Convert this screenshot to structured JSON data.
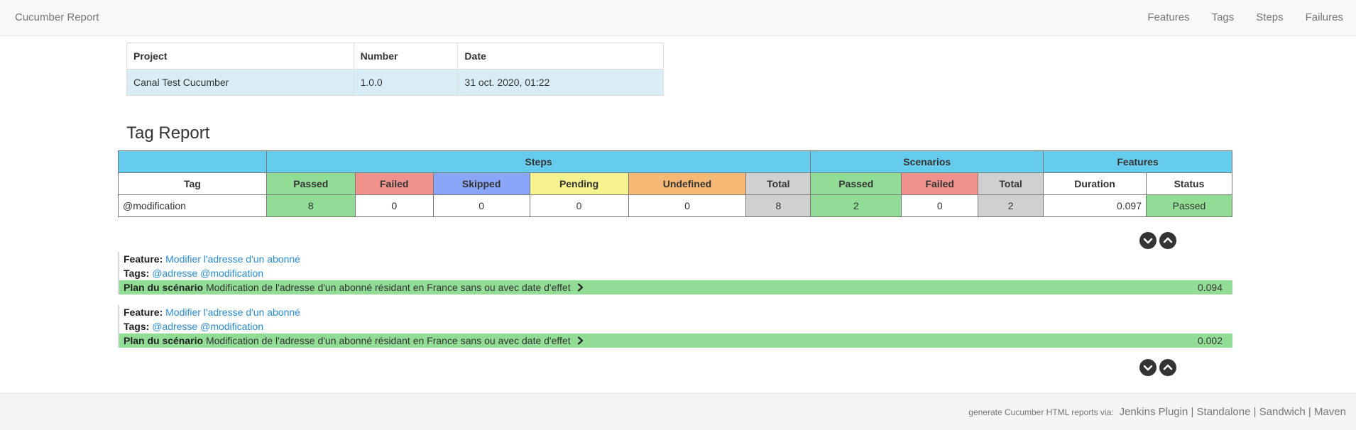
{
  "navbar": {
    "brand": "Cucumber Report",
    "links": [
      "Features",
      "Tags",
      "Steps",
      "Failures"
    ]
  },
  "project": {
    "headers": [
      "Project",
      "Number",
      "Date"
    ],
    "row": [
      "Canal Test Cucumber",
      "1.0.0",
      "31 oct. 2020, 01:22"
    ]
  },
  "tag_report": {
    "title": "Tag Report",
    "groups": [
      "Steps",
      "Scenarios",
      "Features"
    ],
    "columns": [
      "Tag",
      "Passed",
      "Failed",
      "Skipped",
      "Pending",
      "Undefined",
      "Total",
      "Passed",
      "Failed",
      "Total",
      "Duration",
      "Status"
    ],
    "row": [
      "@modification",
      "8",
      "0",
      "0",
      "0",
      "0",
      "8",
      "2",
      "0",
      "2",
      "0.097",
      "Passed"
    ]
  },
  "features": [
    {
      "feature_label": "Feature:",
      "feature_name": "Modifier l'adresse d'un abonné",
      "tags_label": "Tags:",
      "tags": "@adresse @modification",
      "scenario_label": "Plan du scénario",
      "scenario_name": "Modification de l'adresse d'un abonné résidant en France sans ou avec date d'effet",
      "duration": "0.094"
    },
    {
      "feature_label": "Feature:",
      "feature_name": "Modifier l'adresse d'un abonné",
      "tags_label": "Tags:",
      "tags": "@adresse @modification",
      "scenario_label": "Plan du scénario",
      "scenario_name": "Modification de l'adresse d'un abonné résidant en France sans ou avec date d'effet",
      "duration": "0.002"
    }
  ],
  "footer": {
    "prefix": "generate Cucumber HTML reports via:",
    "links": [
      "Jenkins Plugin",
      "Standalone",
      "Sandwich",
      "Maven"
    ],
    "separator": " | "
  },
  "colors": {
    "passed": "#92dd96",
    "failed": "#f2928c",
    "skipped": "#8aa6f8",
    "pending": "#f5f28f",
    "undefined": "#f5b975",
    "total": "#d0d0d0",
    "header": "#66ccee",
    "link": "#2a8bd2"
  },
  "icons": [
    "chevron-down-circle-icon",
    "chevron-up-circle-icon",
    "chevron-right-icon"
  ]
}
